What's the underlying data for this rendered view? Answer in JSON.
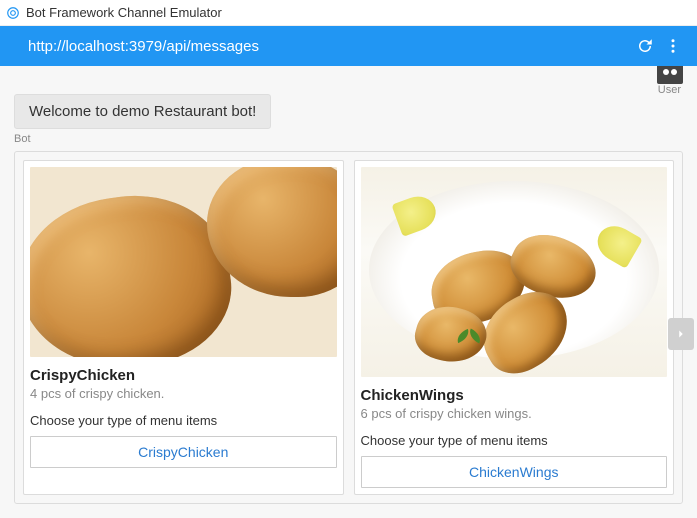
{
  "window": {
    "title": "Bot Framework Channel Emulator"
  },
  "toolbar": {
    "url": "http://localhost:3979/api/messages"
  },
  "user": {
    "label": "User"
  },
  "bot": {
    "welcome": "Welcome to demo Restaurant bot!",
    "label": "Bot"
  },
  "cards": [
    {
      "title": "CrispyChicken",
      "subtitle": "4 pcs of crispy chicken.",
      "prompt": "Choose your type of menu items",
      "button": "CrispyChicken"
    },
    {
      "title": "ChickenWings",
      "subtitle": "6 pcs of crispy chicken wings.",
      "prompt": "Choose your type of menu items",
      "button": "ChickenWings"
    }
  ]
}
